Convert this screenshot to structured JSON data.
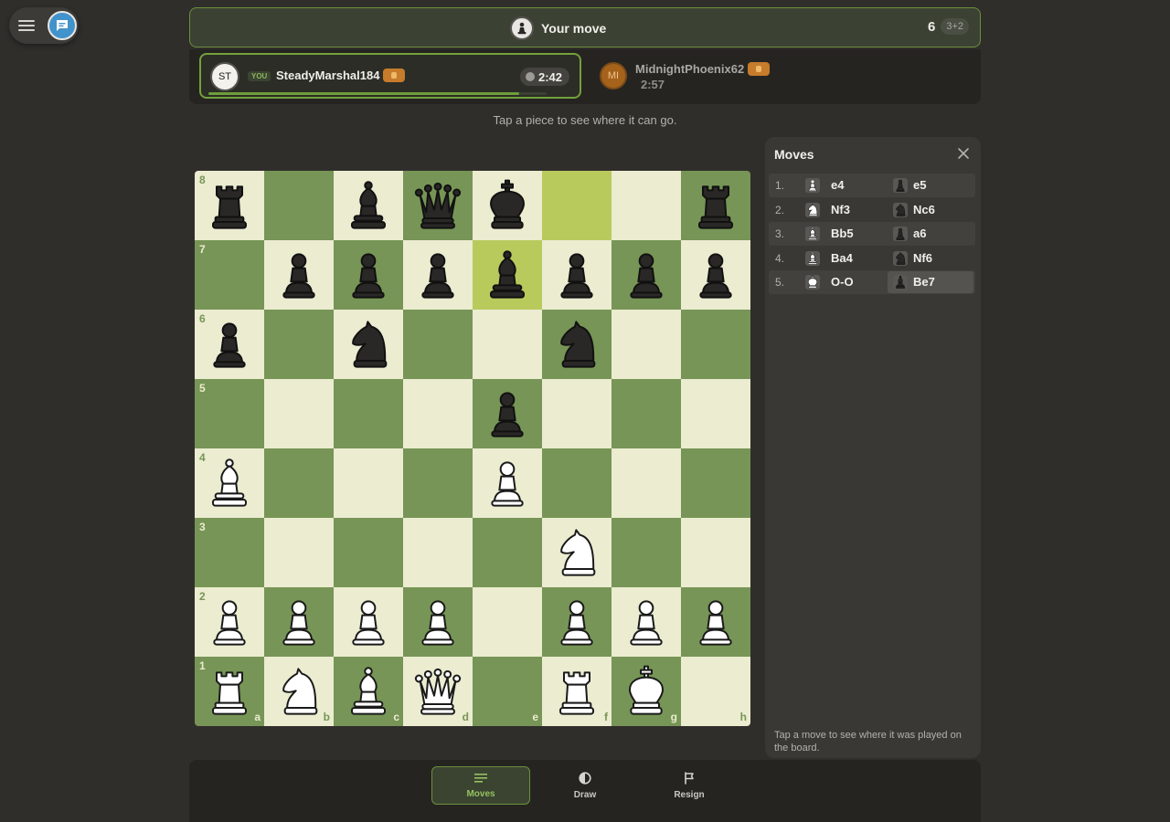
{
  "header": {
    "status_text": "Your move",
    "move_number": "6",
    "time_control": "3+2"
  },
  "players": {
    "you": {
      "initials": "ST",
      "tag": "YOU",
      "name": "SteadyMarshal184",
      "clock": "2:42",
      "time_remaining_fraction": 0.92
    },
    "opponent": {
      "initials": "MI",
      "name": "MidnightPhoenix62",
      "clock": "2:57"
    }
  },
  "hint": "Tap a piece to see where it can go.",
  "board": {
    "orientation": "white",
    "highlighted_squares": [
      "f8",
      "e7"
    ],
    "pieces": [
      {
        "square": "a8",
        "piece": "bR"
      },
      {
        "square": "c8",
        "piece": "bB"
      },
      {
        "square": "d8",
        "piece": "bQ"
      },
      {
        "square": "e8",
        "piece": "bK"
      },
      {
        "square": "h8",
        "piece": "bR"
      },
      {
        "square": "b7",
        "piece": "bP"
      },
      {
        "square": "c7",
        "piece": "bP"
      },
      {
        "square": "d7",
        "piece": "bP"
      },
      {
        "square": "e7",
        "piece": "bB"
      },
      {
        "square": "f7",
        "piece": "bP"
      },
      {
        "square": "g7",
        "piece": "bP"
      },
      {
        "square": "h7",
        "piece": "bP"
      },
      {
        "square": "a6",
        "piece": "bP"
      },
      {
        "square": "c6",
        "piece": "bN"
      },
      {
        "square": "f6",
        "piece": "bN"
      },
      {
        "square": "e5",
        "piece": "bP"
      },
      {
        "square": "a4",
        "piece": "wB"
      },
      {
        "square": "e4",
        "piece": "wP"
      },
      {
        "square": "f3",
        "piece": "wN"
      },
      {
        "square": "a2",
        "piece": "wP"
      },
      {
        "square": "b2",
        "piece": "wP"
      },
      {
        "square": "c2",
        "piece": "wP"
      },
      {
        "square": "d2",
        "piece": "wP"
      },
      {
        "square": "f2",
        "piece": "wP"
      },
      {
        "square": "g2",
        "piece": "wP"
      },
      {
        "square": "h2",
        "piece": "wP"
      },
      {
        "square": "a1",
        "piece": "wR"
      },
      {
        "square": "b1",
        "piece": "wN"
      },
      {
        "square": "c1",
        "piece": "wB"
      },
      {
        "square": "d1",
        "piece": "wQ"
      },
      {
        "square": "f1",
        "piece": "wR"
      },
      {
        "square": "g1",
        "piece": "wK"
      }
    ]
  },
  "moves_panel": {
    "title": "Moves",
    "moves": [
      {
        "num": "1.",
        "white": "e4",
        "white_piece": "P",
        "black": "e5",
        "black_piece": "P"
      },
      {
        "num": "2.",
        "white": "Nf3",
        "white_piece": "N",
        "black": "Nc6",
        "black_piece": "N"
      },
      {
        "num": "3.",
        "white": "Bb5",
        "white_piece": "B",
        "black": "a6",
        "black_piece": "P"
      },
      {
        "num": "4.",
        "white": "Ba4",
        "white_piece": "B",
        "black": "Nf6",
        "black_piece": "N"
      },
      {
        "num": "5.",
        "white": "O-O",
        "white_piece": "K",
        "black": "Be7",
        "black_piece": "B"
      }
    ],
    "footer": "Tap a move to see where it was played on the board."
  },
  "actions": [
    {
      "label": "Moves",
      "icon": "moves-list-icon",
      "active": true
    },
    {
      "label": "Draw",
      "icon": "draw-half-circle-icon",
      "active": false
    },
    {
      "label": "Resign",
      "icon": "flag-icon",
      "active": false
    }
  ],
  "colors": {
    "light_square": "#ebecd0",
    "dark_square": "#779556",
    "highlight_square": "#b9ca5d",
    "accent": "#74a13c",
    "chat_button": "#4293cc"
  }
}
